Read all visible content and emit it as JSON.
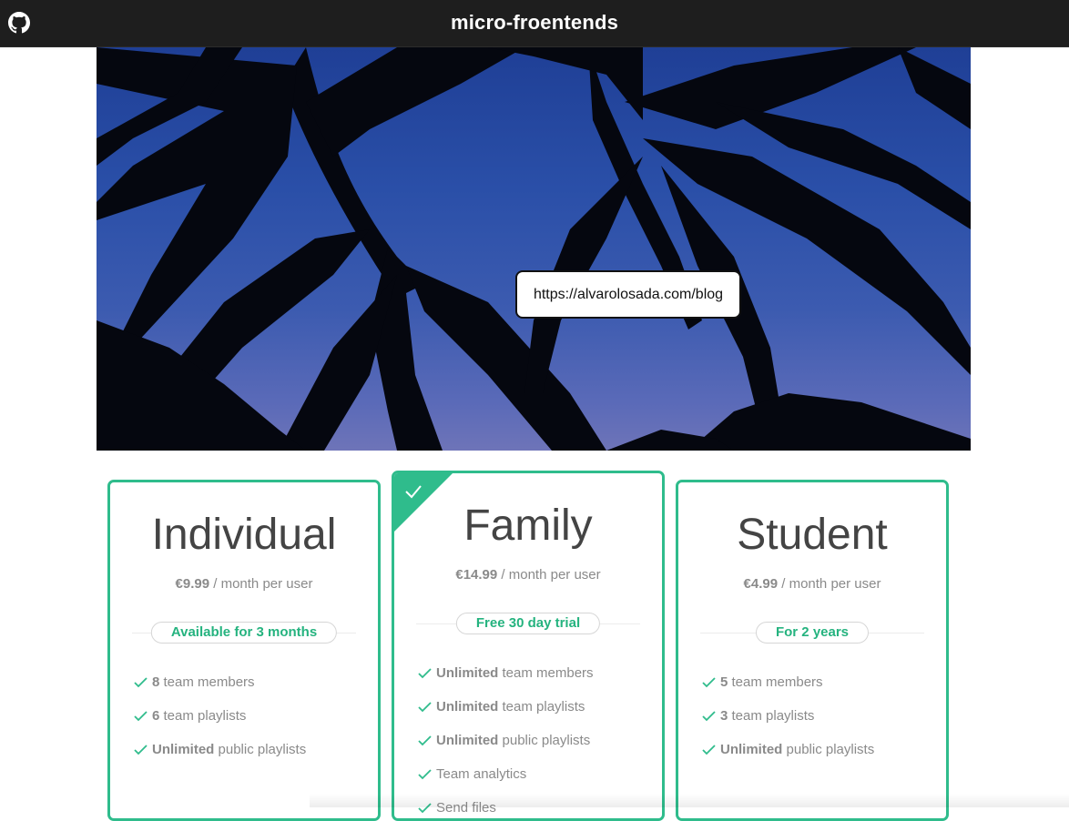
{
  "header": {
    "title": "micro-froentends",
    "github_icon": "github-icon",
    "background": "#1e1e1e"
  },
  "hero": {
    "url_value": "https://alvarolosada.com/blog"
  },
  "theme": {
    "accent": "#2fbc8c",
    "accent_text": "#25b37f",
    "muted_text": "#8a8a8a"
  },
  "plans": [
    {
      "name": "Individual",
      "price": "€9.99",
      "price_suffix": " / month per user",
      "badge": "Available for 3 months",
      "selected": false,
      "features": [
        {
          "bold": "8",
          "text": " team members"
        },
        {
          "bold": "6",
          "text": " team playlists"
        },
        {
          "bold": "Unlimited",
          "text": " public playlists"
        }
      ]
    },
    {
      "name": "Family",
      "price": "€14.99",
      "price_suffix": " / month per user",
      "badge": "Free 30 day trial",
      "selected": true,
      "features": [
        {
          "bold": "Unlimited",
          "text": " team members"
        },
        {
          "bold": "Unlimited",
          "text": " team playlists"
        },
        {
          "bold": "Unlimited",
          "text": " public playlists"
        },
        {
          "bold": "",
          "text": "Team analytics"
        },
        {
          "bold": "",
          "text": "Send files"
        }
      ]
    },
    {
      "name": "Student",
      "price": "€4.99",
      "price_suffix": " / month per user",
      "badge": "For 2 years",
      "selected": false,
      "features": [
        {
          "bold": "5",
          "text": " team members"
        },
        {
          "bold": "3",
          "text": " team playlists"
        },
        {
          "bold": "Unlimited",
          "text": " public playlists"
        }
      ]
    }
  ]
}
